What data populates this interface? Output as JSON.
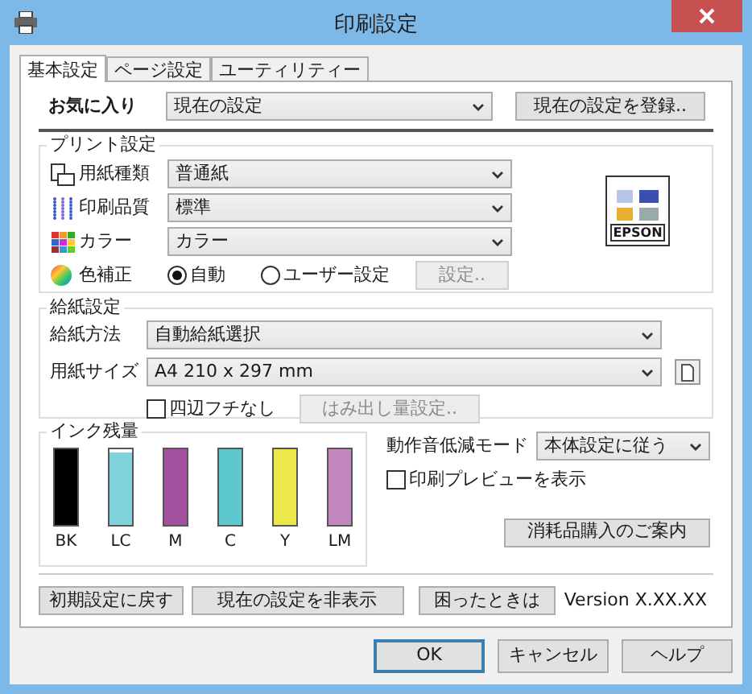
{
  "window": {
    "title": "印刷設定"
  },
  "tabs": [
    {
      "label": "基本設定",
      "selected": true
    },
    {
      "label": "ページ設定",
      "selected": false
    },
    {
      "label": "ユーティリティー",
      "selected": false
    }
  ],
  "favorites": {
    "label": "お気に入り",
    "value": "現在の設定",
    "register_button": "現在の設定を登録.."
  },
  "print_settings": {
    "legend": "プリント設定",
    "rows": [
      {
        "kind": "paper",
        "label": "用紙種類",
        "value": "普通紙"
      },
      {
        "kind": "quality",
        "label": "印刷品質",
        "value": "標準"
      },
      {
        "kind": "color",
        "label": "カラー",
        "value": "カラー"
      }
    ],
    "color_correction": {
      "label": "色補正",
      "options": [
        {
          "label": "自動",
          "selected": true
        },
        {
          "label": "ユーザー設定",
          "selected": false
        }
      ],
      "settings_button": {
        "label": "設定..",
        "disabled": true
      }
    },
    "preview_label": "EPSON"
  },
  "paper_feed": {
    "legend": "給紙設定",
    "source": {
      "label": "給紙方法",
      "value": "自動給紙選択"
    },
    "size": {
      "label": "用紙サイズ",
      "value": "A4 210 x 297 mm"
    },
    "borderless": {
      "label": "四辺フチなし",
      "checked": false
    },
    "expansion_button": {
      "label": "はみ出し量設定..",
      "disabled": true
    }
  },
  "ink": {
    "legend": "インク残量",
    "cartridges": [
      {
        "label": "BK",
        "color": "#000000",
        "level": 1
      },
      {
        "label": "LC",
        "color": "#7fd3dc",
        "level": 0.95
      },
      {
        "label": "M",
        "color": "#a3519f",
        "level": 1
      },
      {
        "label": "C",
        "color": "#5ec8cf",
        "level": 1
      },
      {
        "label": "Y",
        "color": "#ece84a",
        "level": 1
      },
      {
        "label": "LM",
        "color": "#c287bf",
        "level": 1
      }
    ]
  },
  "quiet_mode": {
    "label": "動作音低減モード",
    "value": "本体設定に従う"
  },
  "print_preview": {
    "label": "印刷プレビューを表示",
    "checked": false
  },
  "supplies_button": "消耗品購入のご案内",
  "footer_buttons": [
    "初期設定に戻す",
    "現在の設定を非表示",
    "困ったときは"
  ],
  "version": "Version X.XX.XX",
  "dialog_buttons": [
    {
      "label": "OK",
      "default": true
    },
    {
      "label": "キャンセル",
      "default": false
    },
    {
      "label": "ヘルプ",
      "default": false
    }
  ]
}
